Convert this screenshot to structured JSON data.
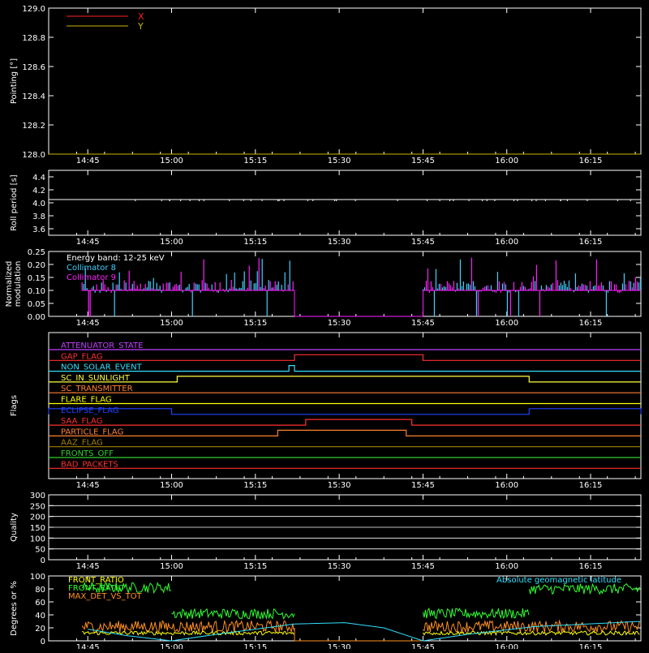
{
  "time_ticks": [
    "14:45",
    "15:00",
    "15:15",
    "15:30",
    "15:45",
    "16:00",
    "16:15"
  ],
  "chart_data": [
    {
      "type": "line",
      "ylabel": "Pointing [°]",
      "ylim": [
        128.0,
        129.0
      ],
      "yticks": [
        "128.0",
        "128.2",
        "128.4",
        "128.6",
        "128.8",
        "129.0"
      ],
      "legend": [
        {
          "name": "X",
          "color": "#ff2020"
        },
        {
          "name": "Y",
          "color": "#c8b800"
        }
      ],
      "series": [
        {
          "name": "X",
          "color": "#ff2020",
          "values": [
            128.0,
            128.0
          ]
        },
        {
          "name": "Y",
          "color": "#c8b800",
          "values": [
            128.0,
            128.0
          ]
        }
      ]
    },
    {
      "type": "line",
      "ylabel": "Roll period [s]",
      "ylim": [
        3.5,
        4.5
      ],
      "yticks": [
        "3.6",
        "3.8",
        "4.0",
        "4.2",
        "4.4"
      ],
      "series": [
        {
          "color": "#ffffff",
          "value": 4.05
        }
      ]
    },
    {
      "type": "line",
      "ylabel": "Normalized modulation",
      "ylim": [
        0.0,
        0.25
      ],
      "yticks": [
        "0.00",
        "0.05",
        "0.10",
        "0.15",
        "0.20",
        "0.25"
      ],
      "annotation": "Energy band: 12-25 keV",
      "legend": [
        {
          "name": "Collimator 8",
          "color": "#40d0ff"
        },
        {
          "name": "Collimator 9",
          "color": "#ff20ff"
        }
      ],
      "active_windows": [
        [
          "14:45",
          "15:22"
        ],
        [
          "15:45",
          "16:24"
        ]
      ],
      "baseline": 0.1
    },
    {
      "type": "line",
      "ylabel": "Flags",
      "flags": [
        {
          "name": "ATTENUATOR_STATE",
          "color": "#c040ff",
          "high": []
        },
        {
          "name": "GAP_FLAG",
          "color": "#ff3030",
          "high": [
            [
              "15:22",
              "15:45"
            ]
          ]
        },
        {
          "name": "NON_SOLAR_EVENT",
          "color": "#30e0ff",
          "high": [
            [
              "15:21",
              "15:22"
            ]
          ]
        },
        {
          "name": "SC_IN_SUNLIGHT",
          "color": "#ffff40",
          "high": [
            [
              "15:01",
              "16:04"
            ]
          ]
        },
        {
          "name": "SC_TRANSMITTER",
          "color": "#ff8030",
          "high": []
        },
        {
          "name": "FLARE_FLAG",
          "color": "#ffff00",
          "high": []
        },
        {
          "name": "ECLIPSE_FLAG",
          "color": "#2040ff",
          "high": [
            [
              "14:45",
              "15:00"
            ],
            [
              "16:04",
              "16:24"
            ]
          ]
        },
        {
          "name": "SAA_FLAG",
          "color": "#ff3030",
          "high": [
            [
              "15:24",
              "15:43"
            ]
          ]
        },
        {
          "name": "PARTICLE_FLAG",
          "color": "#ff8030",
          "high": [
            [
              "15:19",
              "15:42"
            ]
          ]
        },
        {
          "name": "AAZ_FLAG",
          "color": "#a08000",
          "high": []
        },
        {
          "name": "FRONTS_OFF",
          "color": "#30d030",
          "high": []
        },
        {
          "name": "BAD_PACKETS",
          "color": "#ff3030",
          "high": []
        }
      ]
    },
    {
      "type": "line",
      "ylabel": "Quality",
      "ylim": [
        0,
        300
      ],
      "yticks": [
        "0",
        "50",
        "100",
        "150",
        "200",
        "250",
        "300"
      ],
      "grid": true
    },
    {
      "type": "line",
      "ylabel": "Degrees or %",
      "ylim": [
        0,
        100
      ],
      "yticks": [
        "0",
        "20",
        "40",
        "60",
        "80",
        "100"
      ],
      "legend": [
        {
          "name": "FRONT_RATIO",
          "color": "#ffff00"
        },
        {
          "name": "FRONT_RATIO",
          "color": "#30ff30"
        },
        {
          "name": "MAX_DET_VS_TOT",
          "color": "#ff9020"
        }
      ],
      "annotation": "Absolute geomagnetic latitude",
      "annotation_color": "#30e0ff",
      "series": [
        {
          "name": "Absolute geomagnetic latitude",
          "color": "#30e0ff",
          "points": [
            [
              "14:45",
              18
            ],
            [
              "14:52",
              8
            ],
            [
              "15:00",
              0
            ],
            [
              "15:08",
              10
            ],
            [
              "15:22",
              26
            ],
            [
              "15:31",
              28
            ],
            [
              "15:38",
              20
            ],
            [
              "15:45",
              0
            ],
            [
              "15:53",
              10
            ],
            [
              "16:05",
              22
            ],
            [
              "16:24",
              30
            ]
          ]
        },
        {
          "name": "FRONT_RATIO",
          "color": "#30ff30",
          "level_windows": [
            [
              "14:45",
              "15:00",
              82
            ],
            [
              "15:00",
              "15:22",
              42
            ],
            [
              "15:45",
              "16:04",
              42
            ],
            [
              "16:04",
              "16:24",
              80
            ]
          ]
        },
        {
          "name": "MAX_DET_VS_TOT",
          "color": "#ff9020",
          "level": 22
        },
        {
          "name": "FRONT_RATIO",
          "color": "#ffff00",
          "level": 12
        }
      ]
    }
  ]
}
